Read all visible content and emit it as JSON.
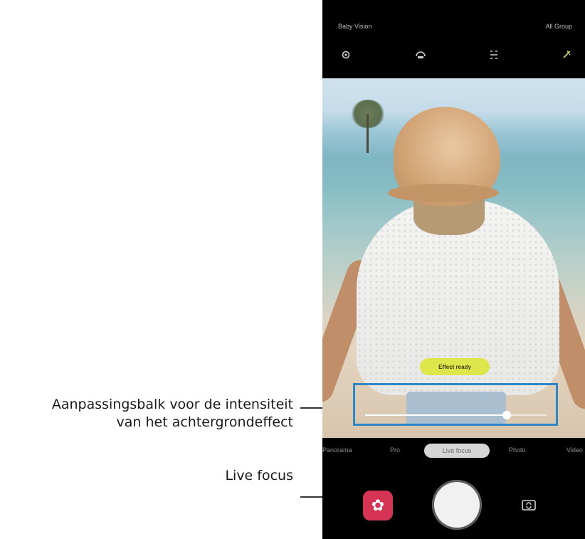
{
  "callouts": {
    "intensity_line1": "Aanpassingsbalk voor de intensiteit",
    "intensity_line2": "van het achtergrondeffect",
    "live_focus": "Live focus"
  },
  "phone": {
    "status": {
      "left": "Baby Vision",
      "right": "All Group"
    },
    "toolbar_icons": [
      "settings-icon",
      "timer-icon",
      "ratio-icon",
      "effect-icon"
    ],
    "effect_badge": "Effect ready",
    "intensity_slider": {
      "level": 0.78
    },
    "modes": {
      "panorama": "Panorama",
      "pro": "Pro",
      "live_focus": "Live focus",
      "photo": "Photo",
      "video": "Video",
      "selected": "Live focus"
    },
    "colors": {
      "highlight": "#2e88c8",
      "badge": "#dde64a",
      "bixby": "#d53455"
    }
  }
}
